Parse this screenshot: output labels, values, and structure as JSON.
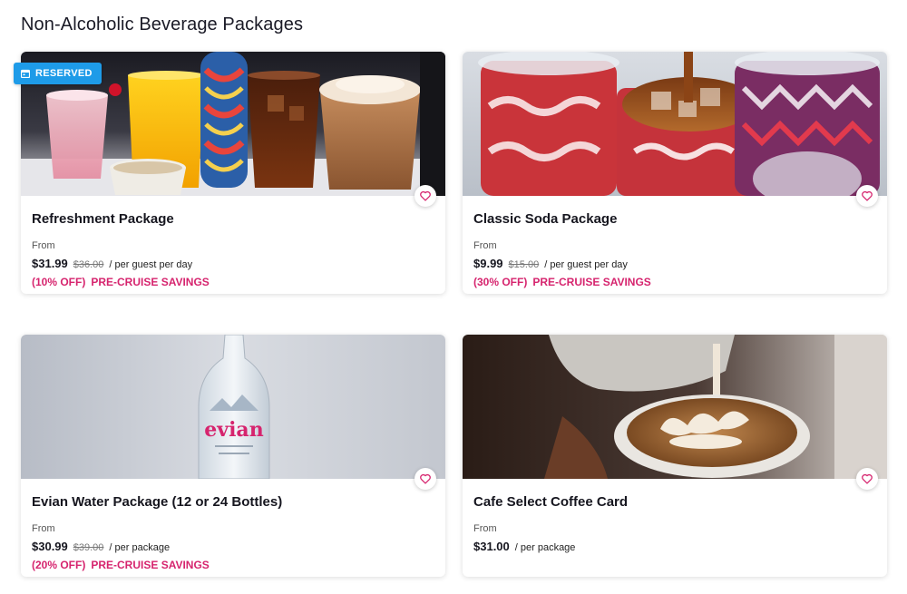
{
  "page": {
    "section_title": "Non-Alcoholic Beverage Packages"
  },
  "colors": {
    "accent_pink": "#d6246e",
    "badge_blue": "#1e9be8"
  },
  "cards": [
    {
      "image_alt": "Assorted drinks: smoothie, juice, soda, iced coffee",
      "badge": "RESERVED",
      "title": "Refreshment Package",
      "from": "From",
      "price": "$31.99",
      "original_price": "$36.00",
      "unit": "/ per guest per day",
      "discount": "(10% OFF)",
      "savings": "PRE-CRUISE SAVINGS",
      "favorite_icon": "heart-icon"
    },
    {
      "image_alt": "Soda cups with ice",
      "title": "Classic Soda Package",
      "from": "From",
      "price": "$9.99",
      "original_price": "$15.00",
      "unit": "/ per guest per day",
      "discount": "(30% OFF)",
      "savings": "PRE-CRUISE SAVINGS",
      "favorite_icon": "heart-icon"
    },
    {
      "image_alt": "Evian water bottle",
      "bottle_label": "evian",
      "title": "Evian Water Package (12 or 24 Bottles)",
      "from": "From",
      "price": "$30.99",
      "original_price": "$39.00",
      "unit": "/ per package",
      "discount": "(20% OFF)",
      "savings": "PRE-CRUISE SAVINGS",
      "favorite_icon": "heart-icon"
    },
    {
      "image_alt": "Latte art being poured",
      "title": "Cafe Select Coffee Card",
      "from": "From",
      "price": "$31.00",
      "unit": "/ per package",
      "favorite_icon": "heart-icon"
    }
  ]
}
